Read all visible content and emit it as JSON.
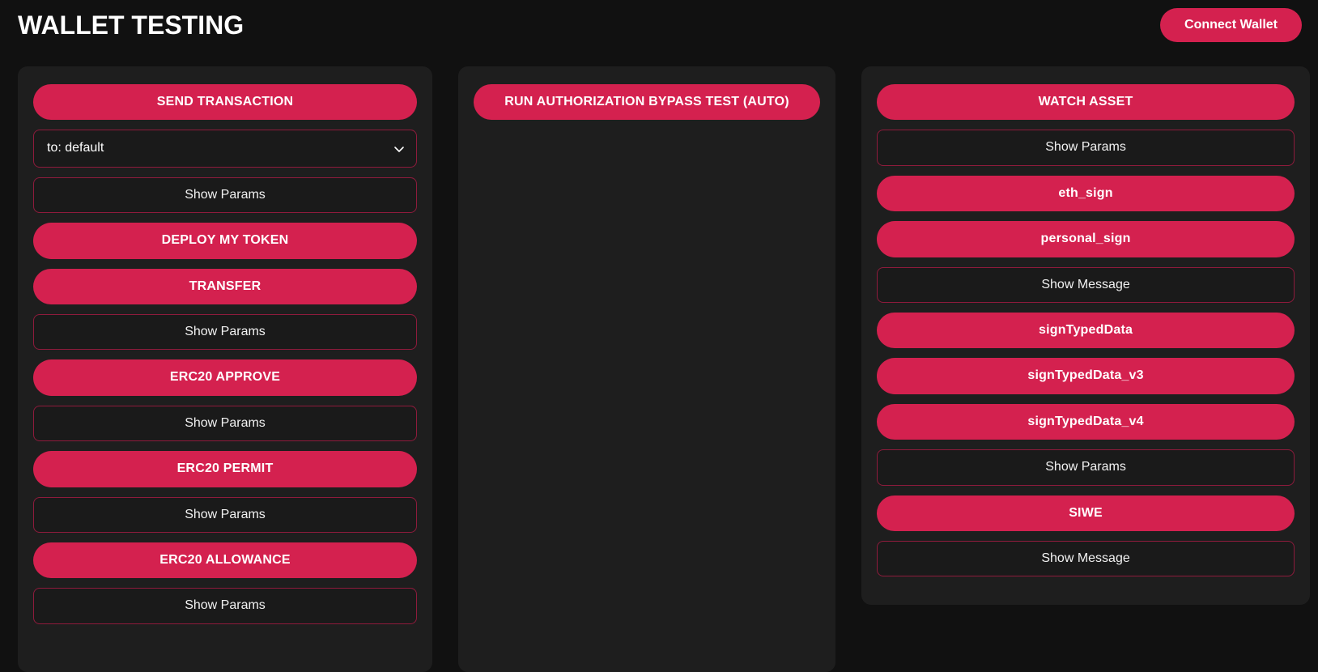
{
  "header": {
    "title": "WALLET TESTING",
    "connect_wallet_label": "Connect Wallet"
  },
  "theme": {
    "page_background": "#111111",
    "panel_background": "#1e1e1e",
    "accent": "#d4214f",
    "outline_border": "#8e1b3c",
    "text": "#ffffff"
  },
  "columns": {
    "left": {
      "items": [
        {
          "kind": "primary",
          "label": "SEND TRANSACTION",
          "name": "send-transaction-button"
        },
        {
          "kind": "select",
          "label": "to: default",
          "name": "send-transaction-to-select"
        },
        {
          "kind": "outline",
          "label": "Show Params",
          "name": "show-params-send-transaction-button"
        },
        {
          "kind": "primary",
          "label": "DEPLOY MY TOKEN",
          "name": "deploy-my-token-button"
        },
        {
          "kind": "primary",
          "label": "TRANSFER",
          "name": "transfer-button"
        },
        {
          "kind": "outline",
          "label": "Show Params",
          "name": "show-params-transfer-button"
        },
        {
          "kind": "primary",
          "label": "ERC20 APPROVE",
          "name": "erc20-approve-button"
        },
        {
          "kind": "outline",
          "label": "Show Params",
          "name": "show-params-erc20-approve-button"
        },
        {
          "kind": "primary",
          "label": "ERC20 PERMIT",
          "name": "erc20-permit-button"
        },
        {
          "kind": "outline",
          "label": "Show Params",
          "name": "show-params-erc20-permit-button"
        },
        {
          "kind": "primary",
          "label": "ERC20 ALLOWANCE",
          "name": "erc20-allowance-button"
        },
        {
          "kind": "outline",
          "label": "Show Params",
          "name": "show-params-erc20-allowance-button"
        }
      ]
    },
    "middle": {
      "items": [
        {
          "kind": "primary",
          "label": "RUN AUTHORIZATION BYPASS TEST (AUTO)",
          "name": "run-authorization-bypass-test-button"
        }
      ]
    },
    "right": {
      "items": [
        {
          "kind": "primary",
          "label": "WATCH ASSET",
          "name": "watch-asset-button"
        },
        {
          "kind": "outline",
          "label": "Show Params",
          "name": "show-params-watch-asset-button"
        },
        {
          "kind": "primary",
          "label": "eth_sign",
          "name": "eth-sign-button"
        },
        {
          "kind": "primary",
          "label": "personal_sign",
          "name": "personal-sign-button"
        },
        {
          "kind": "outline",
          "label": "Show Message",
          "name": "show-message-personal-sign-button"
        },
        {
          "kind": "primary",
          "label": "signTypedData",
          "name": "sign-typed-data-button"
        },
        {
          "kind": "primary",
          "label": "signTypedData_v3",
          "name": "sign-typed-data-v3-button"
        },
        {
          "kind": "primary",
          "label": "signTypedData_v4",
          "name": "sign-typed-data-v4-button"
        },
        {
          "kind": "outline",
          "label": "Show Params",
          "name": "show-params-sign-typed-data-button"
        },
        {
          "kind": "primary",
          "label": "SIWE",
          "name": "siwe-button"
        },
        {
          "kind": "outline",
          "label": "Show Message",
          "name": "show-message-siwe-button"
        }
      ]
    }
  }
}
